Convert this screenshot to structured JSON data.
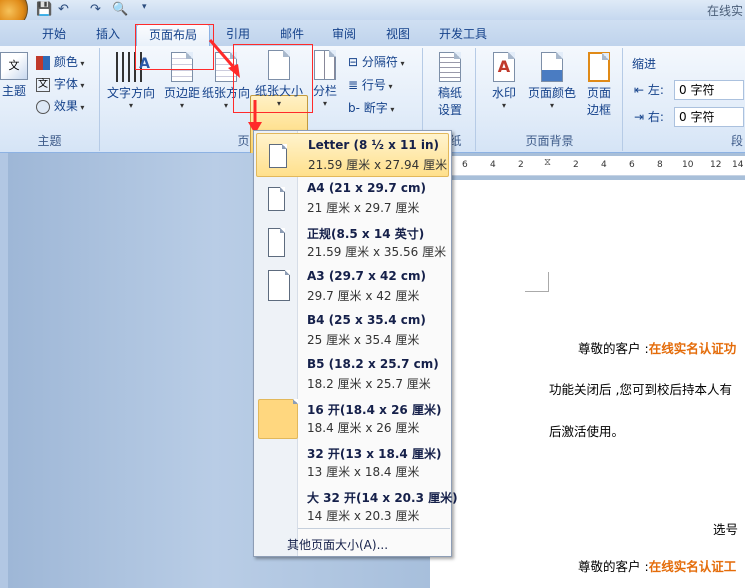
{
  "titlebar": {
    "title": "在线实"
  },
  "tabs": [
    {
      "label": "开始"
    },
    {
      "label": "插入"
    },
    {
      "label": "页面布局"
    },
    {
      "label": "引用"
    },
    {
      "label": "邮件"
    },
    {
      "label": "审阅"
    },
    {
      "label": "视图"
    },
    {
      "label": "开发工具"
    }
  ],
  "ribbon": {
    "theme_group": {
      "label": "主题",
      "theme": "主题",
      "colors": "颜色",
      "fonts": "字体",
      "effects": "效果"
    },
    "page_setup_group": {
      "label": "页面设置",
      "text_direction": "文字方向",
      "margins": "页边距",
      "orientation": "纸张方向",
      "size": "纸张大小",
      "columns": "分栏",
      "breaks": "分隔符",
      "line_numbers": "行号",
      "hyphenation": "断字"
    },
    "paper_group": {
      "label": "稿纸",
      "paper_setup": "稿纸设置"
    },
    "background_group": {
      "label": "页面背景",
      "watermark": "水印",
      "page_color": "页面颜色",
      "page_borders": "页面边框"
    },
    "paragraph_group": {
      "indent": "缩进",
      "left_label": "左:",
      "left_value": "0 字符",
      "right_label": "右:",
      "right_value": "0 字符",
      "label": "段"
    }
  },
  "ruler": {
    "ticks": [
      "6",
      "4",
      "2",
      "",
      "2",
      "4",
      "6",
      "8",
      "10",
      "12",
      "14",
      "16"
    ]
  },
  "document": {
    "line1_prefix": "尊敬的客户 :",
    "line1_highlight": "在线实名认证功",
    "line2": "功能关闭后 ,您可到校后持本人有",
    "line3": "后激活使用。",
    "line4": "选号",
    "line5_prefix": "尊敬的客户 :",
    "line5_highlight": "在线实名认证工"
  },
  "paper_size_menu": {
    "items": [
      {
        "name": "Letter (8 ½ x 11 in)",
        "size": "21.59 厘米 x 27.94 厘米",
        "selected": true
      },
      {
        "name": "A4 (21 x 29.7 cm)",
        "size": "21 厘米 x 29.7 厘米"
      },
      {
        "name": "正规(8.5 x 14 英寸)",
        "size": "21.59 厘米 x 35.56 厘米"
      },
      {
        "name": "A3 (29.7 x 42 cm)",
        "size": "29.7 厘米 x 42 厘米"
      },
      {
        "name": "B4 (25 x 35.4 cm)",
        "size": "25 厘米 x 35.4 厘米"
      },
      {
        "name": "B5 (18.2 x 25.7 cm)",
        "size": "18.2 厘米 x 25.7 厘米"
      },
      {
        "name": "16 开(18.4 x 26 厘米)",
        "size": "18.4 厘米 x 26 厘米"
      },
      {
        "name": "32 开(13 x 18.4 厘米)",
        "size": "13 厘米 x 18.4 厘米"
      },
      {
        "name": "大 32 开(14 x 20.3 厘米)",
        "size": "14 厘米 x 20.3 厘米"
      }
    ],
    "more": "其他页面大小(A)..."
  }
}
